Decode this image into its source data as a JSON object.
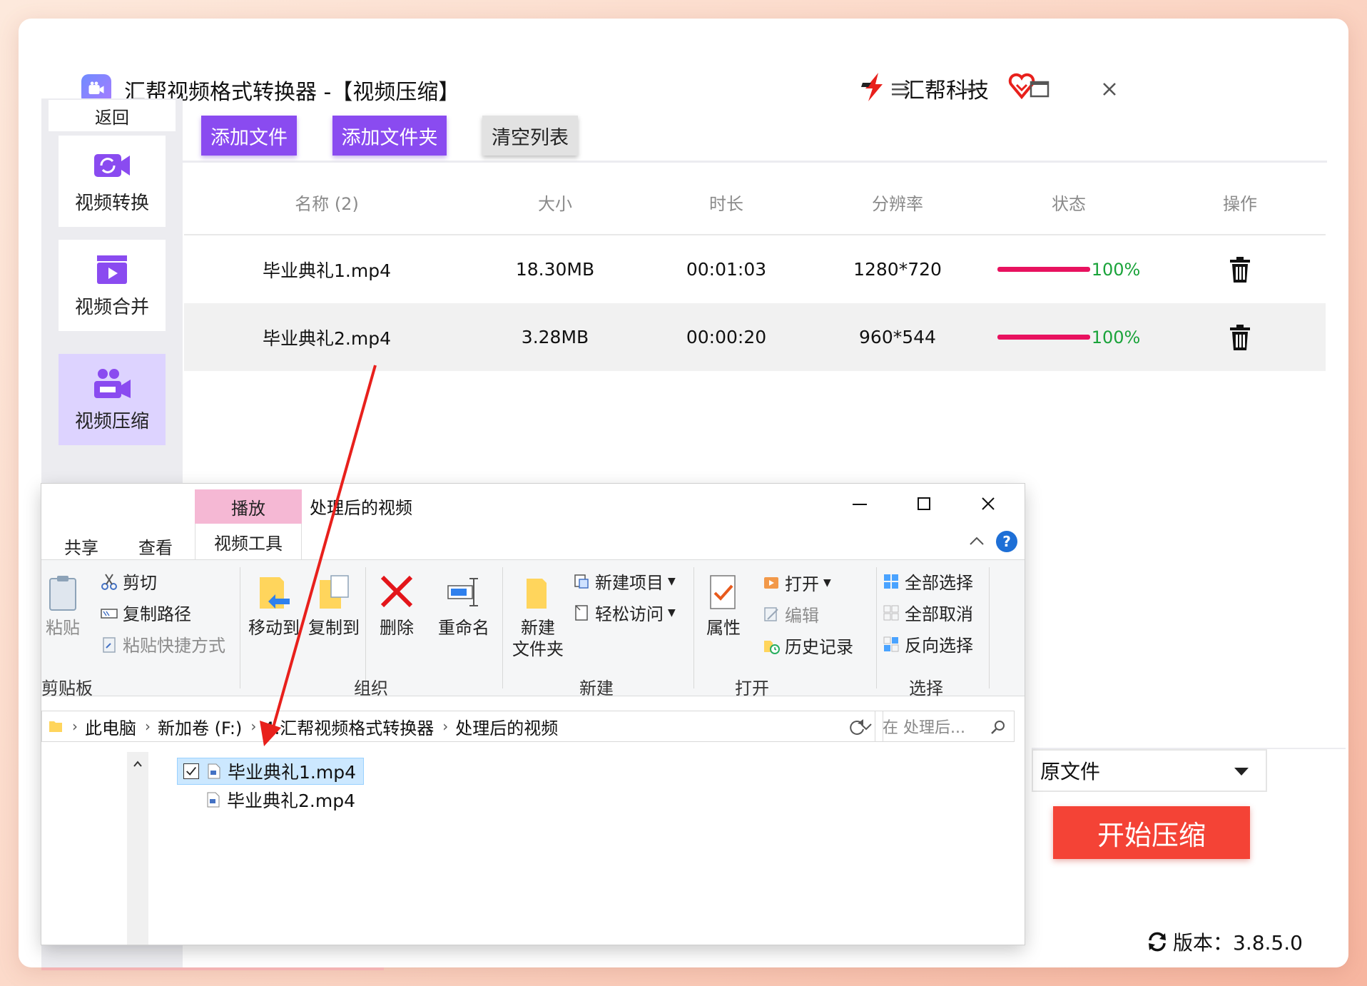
{
  "app": {
    "title": "汇帮视频格式转换器  -【视频压缩】",
    "brand": "汇帮科技"
  },
  "sidebar": {
    "back": "返回",
    "items": [
      {
        "label": "视频转换",
        "icon": "video-convert-icon"
      },
      {
        "label": "视频合并",
        "icon": "video-merge-icon"
      },
      {
        "label": "视频压缩",
        "icon": "video-compress-icon",
        "active": true
      }
    ]
  },
  "toolbar": {
    "add_file": "添加文件",
    "add_folder": "添加文件夹",
    "clear_list": "清空列表"
  },
  "table": {
    "headers": [
      "名称 (2)",
      "大小",
      "时长",
      "分辨率",
      "状态",
      "操作"
    ],
    "rows": [
      {
        "name": "毕业典礼1.mp4",
        "size": "18.30MB",
        "duration": "00:01:03",
        "resolution": "1280*720",
        "progress": "100%"
      },
      {
        "name": "毕业典礼2.mp4",
        "size": "3.28MB",
        "duration": "00:00:20",
        "resolution": "960*544",
        "progress": "100%"
      }
    ]
  },
  "output": {
    "select_value": "原文件",
    "start_button": "开始压缩",
    "version": "版本：3.8.5.0"
  },
  "explorer": {
    "context_tab": "播放",
    "title": "处理后的视频",
    "tabs": {
      "share": "共享",
      "view": "查看",
      "tools": "视频工具"
    },
    "clipboard": {
      "paste": "粘贴",
      "cut": "剪切",
      "copy_path": "复制路径",
      "paste_shortcut": "粘贴快捷方式",
      "label": "剪贴板"
    },
    "organize": {
      "move_to": "移动到",
      "copy_to": "复制到",
      "delete": "删除",
      "rename": "重命名",
      "label": "组织"
    },
    "new": {
      "new_folder_line1": "新建",
      "new_folder_line2": "文件夹",
      "new_item": "新建项目",
      "easy_access": "轻松访问",
      "label": "新建"
    },
    "open": {
      "properties": "属性",
      "open": "打开",
      "edit": "编辑",
      "history": "历史记录",
      "label": "打开"
    },
    "select": {
      "select_all": "全部选择",
      "select_none": "全部取消",
      "invert": "反向选择",
      "label": "选择"
    },
    "address": [
      "此电脑",
      "新加卷 (F:)",
      "4.汇帮视频格式转换器",
      "处理后的视频"
    ],
    "search_placeholder": "在 处理后...",
    "files": [
      "毕业典礼1.mp4",
      "毕业典礼2.mp4"
    ]
  },
  "colors": {
    "accent_purple": "#8a4bf0",
    "start_red": "#f44336",
    "progress_bar": "#e8125f",
    "progress_text": "#1aa33a",
    "annotation_arrow": "#e8201c"
  }
}
